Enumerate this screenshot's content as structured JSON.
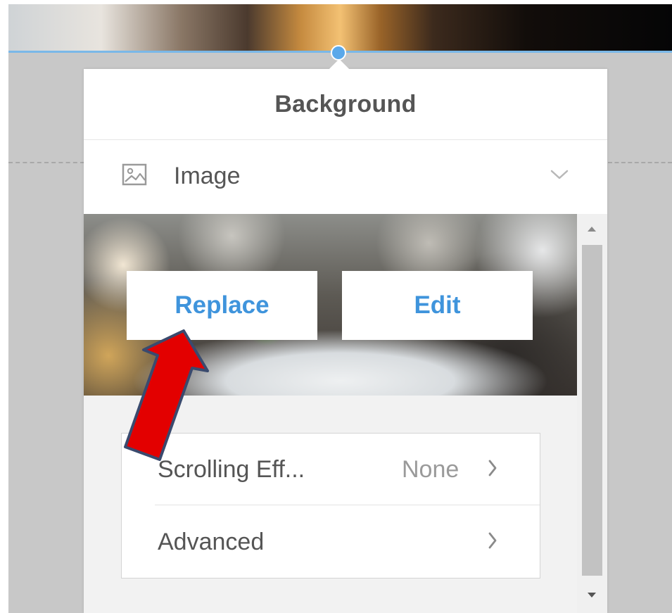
{
  "panel": {
    "title": "Background",
    "type_selector": {
      "label": "Image",
      "icon": "image-icon",
      "chevron": "chevron-down-icon"
    },
    "image_preview": {
      "replace_label": "Replace",
      "edit_label": "Edit"
    },
    "settings": [
      {
        "label": "Scrolling Eff...",
        "value": "None",
        "icon": "chevron-right-icon"
      },
      {
        "label": "Advanced",
        "value": "",
        "icon": "chevron-right-icon"
      }
    ]
  },
  "annotation": {
    "icon": "red-arrow-annotation",
    "color": "#e30000",
    "outline": "#3a4a6e"
  },
  "colors": {
    "accent": "#3f94dc",
    "selection": "#7ab8e8",
    "panel_background": "#f2f2f2",
    "canvas_background": "#c8c8c8"
  }
}
